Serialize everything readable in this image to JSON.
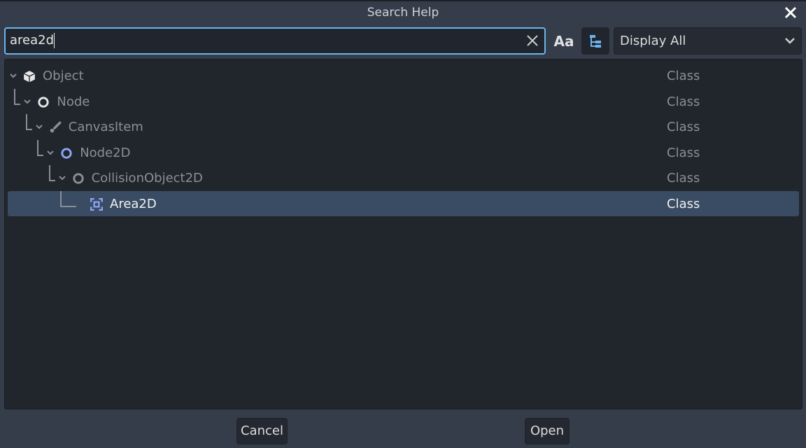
{
  "dialog": {
    "title": "Search Help"
  },
  "search": {
    "value": "area2d"
  },
  "filter": {
    "selected": "Display All"
  },
  "tree": [
    {
      "name": "Object",
      "kind": "Class",
      "icon": "object-icon"
    },
    {
      "name": "Node",
      "kind": "Class",
      "icon": "node-icon"
    },
    {
      "name": "CanvasItem",
      "kind": "Class",
      "icon": "canvas-item-icon"
    },
    {
      "name": "Node2D",
      "kind": "Class",
      "icon": "node2d-icon"
    },
    {
      "name": "CollisionObject2D",
      "kind": "Class",
      "icon": "collision-object2d-icon"
    },
    {
      "name": "Area2D",
      "kind": "Class",
      "icon": "area2d-icon",
      "selected": true
    }
  ],
  "buttons": {
    "cancel": "Cancel",
    "open": "Open",
    "case_sensitive": "Aa"
  },
  "colors": {
    "accent": "#6cb4ef",
    "selection": "#394c63",
    "node2d": "#8da5f3"
  }
}
